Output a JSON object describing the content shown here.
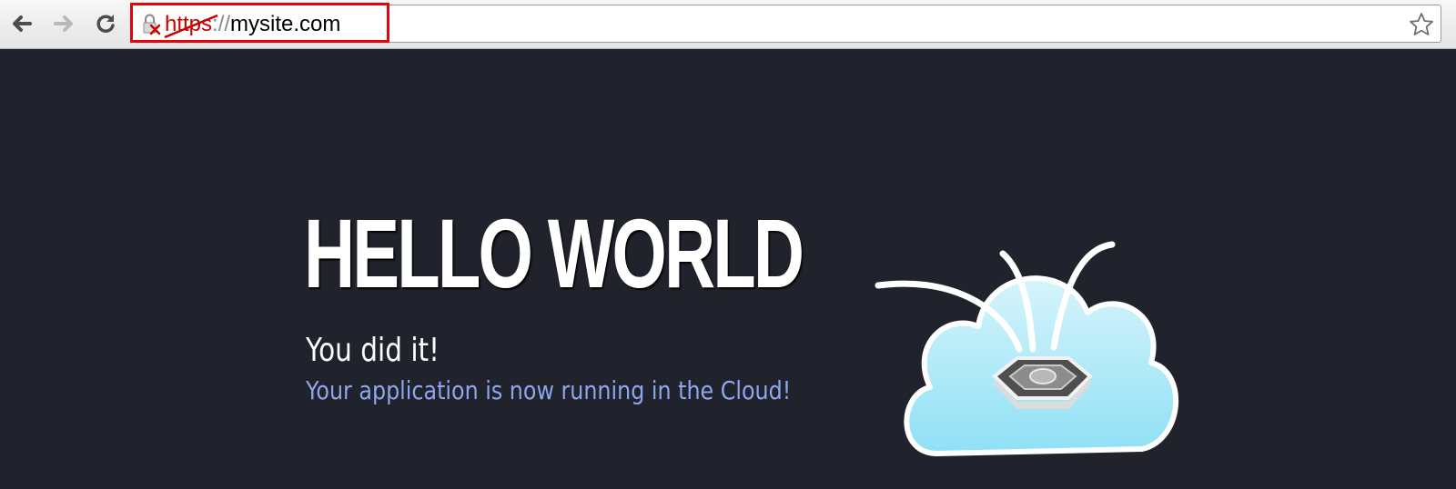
{
  "browser": {
    "url_scheme": "https",
    "url_separator": "://",
    "url_host": "mysite.com",
    "icons": {
      "back": "back-arrow-icon",
      "forward": "forward-arrow-icon",
      "reload": "reload-icon",
      "security": "broken-lock-icon",
      "bookmark": "star-icon"
    },
    "highlight_color": "#e8000b",
    "insecure_scheme_color": "#c80000"
  },
  "page": {
    "background_color": "#20232b",
    "heading": "HELLO WORLD",
    "subheading": "You did it!",
    "message": "Your application is now running in the Cloud!",
    "message_color": "#8fa6ee",
    "logo": "cloud-foundry-logo"
  }
}
